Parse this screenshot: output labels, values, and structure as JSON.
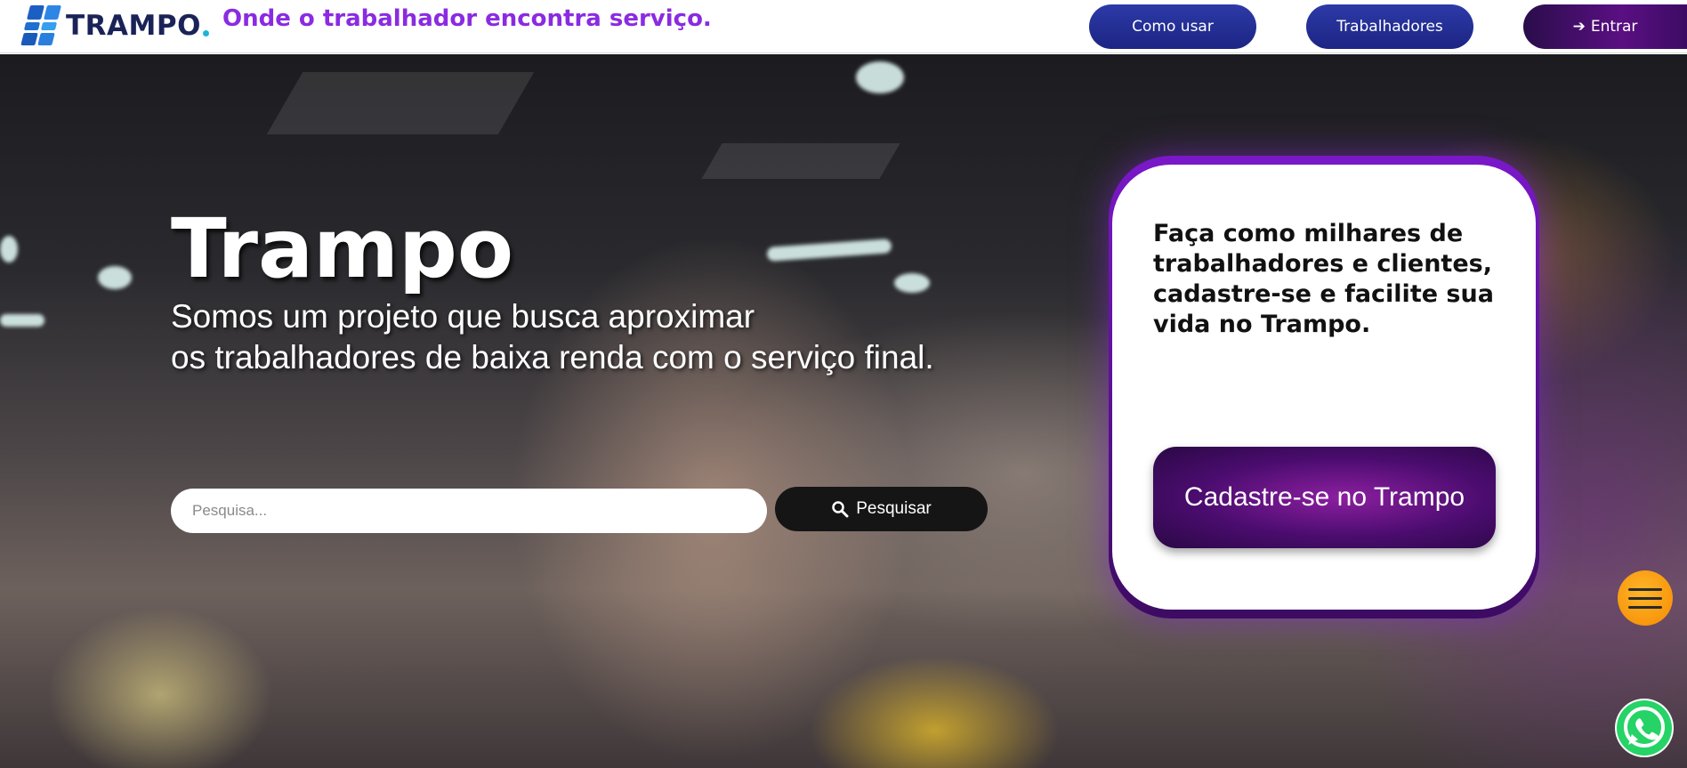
{
  "header": {
    "logo_text": "TRAMPO",
    "tagline": "Onde o trabalhador encontra serviço.",
    "nav": {
      "como_usar": "Como usar",
      "trabalhadores": "Trabalhadores",
      "entrar": "Entrar"
    }
  },
  "hero": {
    "title": "Trampo",
    "subtitle_line1": "Somos um projeto que busca aproximar",
    "subtitle_line2": "os trabalhadores de baixa renda com o serviço final.",
    "search": {
      "placeholder": "Pesquisa...",
      "value": "",
      "button_label": "Pesquisar"
    }
  },
  "card": {
    "text": "Faça como milhares de trabalhadores e clientes, cadastre-se e facilite sua vida no Trampo.",
    "button_label": "Cadastre-se no Trampo"
  },
  "floating": {
    "menu_icon": "menu-icon",
    "whatsapp_icon": "whatsapp-icon"
  },
  "colors": {
    "brand_navy": "#1a2358",
    "tagline_purple": "#8a2be2",
    "nav_blue": "#1c2583",
    "deep_purple": "#3d0b63",
    "menu_orange": "#f58a00",
    "whatsapp_green": "#25d366"
  }
}
